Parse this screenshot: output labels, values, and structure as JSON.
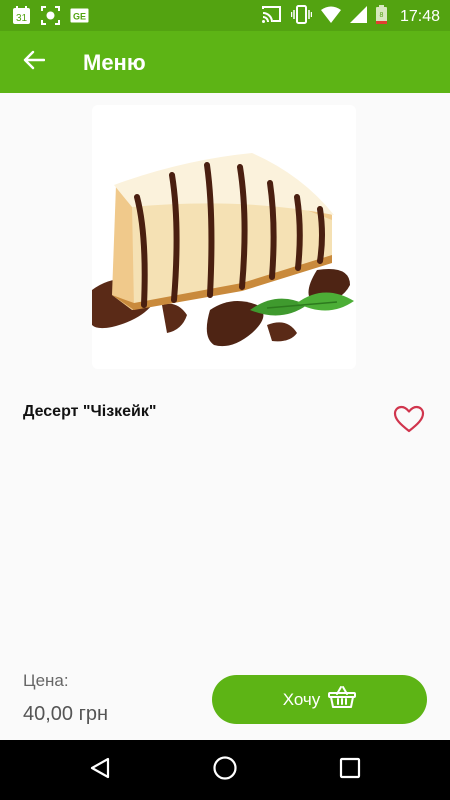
{
  "status_bar": {
    "time": "17:48",
    "left_icons": [
      "calendar-icon",
      "screenshot-icon",
      "ge-icon"
    ],
    "calendar_day": "31",
    "ge_label": "GE",
    "right_icons": [
      "cast-icon",
      "vibrate-icon",
      "wifi-icon",
      "signal-icon",
      "battery-icon"
    ],
    "battery_level": "8"
  },
  "app_bar": {
    "title": "Меню",
    "back_icon": "arrow-left-icon"
  },
  "product": {
    "name": "Десерт \"Чізкейк\"",
    "image": "cheesecake-image",
    "favorite_icon": "heart-outline-icon"
  },
  "price": {
    "label": "Цена:",
    "value": "40,00 грн"
  },
  "action": {
    "want_label": "Хочу",
    "basket_icon": "basket-icon"
  },
  "nav_bar": {
    "items": [
      "back-triangle-icon",
      "home-circle-icon",
      "recents-square-icon"
    ]
  },
  "colors": {
    "status_bar": "#53a311",
    "app_bar": "#5db415",
    "accent": "#5db415",
    "heart": "#d0354d",
    "background": "#fafafa"
  }
}
